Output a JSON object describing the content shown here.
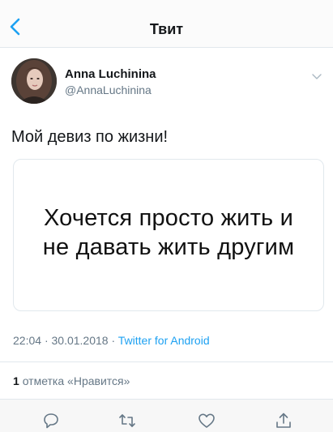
{
  "header": {
    "title": "Твит",
    "back_icon": "chevron-left-icon"
  },
  "author": {
    "name": "Anna Luchinina",
    "handle": "@AnnaLuchinina",
    "menu_icon": "chevron-down-icon"
  },
  "tweet": {
    "text": "Мой девиз по жизни!",
    "media": {
      "line1": "Хочется просто жить и",
      "line2": "не давать жить другим"
    },
    "time": "22:04",
    "date": "30.01.2018",
    "separator": "·",
    "source": "Twitter for Android"
  },
  "engagement": {
    "like_count": "1",
    "like_label": "отметка «Нравится»"
  },
  "actions": {
    "icons": [
      "reply-icon",
      "retweet-icon",
      "like-icon",
      "share-icon"
    ]
  },
  "colors": {
    "accent": "#1da1f2",
    "secondary_text": "#657786",
    "border": "#e1e8ed"
  }
}
